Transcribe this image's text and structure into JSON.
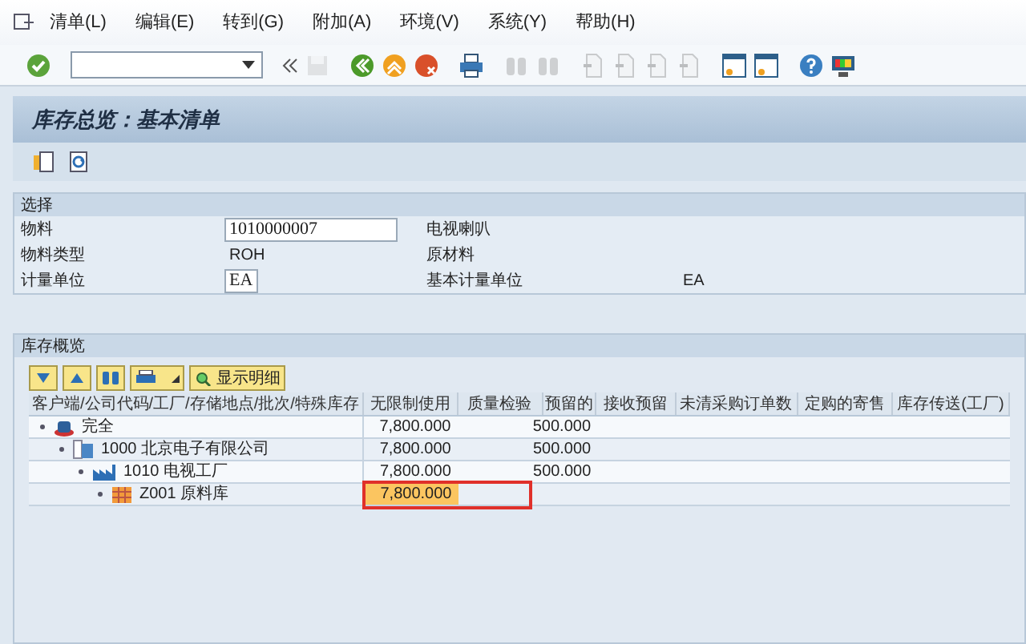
{
  "menu": [
    {
      "label": "清单(L)"
    },
    {
      "label": "编辑(E)"
    },
    {
      "label": "转到(G)"
    },
    {
      "label": "附加(A)"
    },
    {
      "label": "环境(V)"
    },
    {
      "label": "系统(Y)"
    },
    {
      "label": "帮助(H)"
    }
  ],
  "toolbar": {
    "buttons": [
      {
        "kind": "enter",
        "disabled": false
      },
      {
        "kind": "save",
        "disabled": true
      },
      {
        "kind": "back",
        "disabled": false
      },
      {
        "kind": "exit",
        "disabled": false
      },
      {
        "kind": "cancel",
        "disabled": false
      },
      {
        "kind": "print",
        "disabled": false
      },
      {
        "kind": "find",
        "disabled": true
      },
      {
        "kind": "find",
        "disabled": true
      },
      {
        "kind": "page",
        "disabled": true
      },
      {
        "kind": "page",
        "disabled": true
      },
      {
        "kind": "page",
        "disabled": true
      },
      {
        "kind": "page",
        "disabled": true
      },
      {
        "kind": "window",
        "disabled": false
      },
      {
        "kind": "window",
        "disabled": false
      },
      {
        "kind": "help",
        "disabled": false
      },
      {
        "kind": "monitor",
        "disabled": false
      }
    ]
  },
  "title": "库存总览：基本清单",
  "selection": {
    "title": "选择",
    "rows": [
      {
        "label": "物料",
        "kind": "field",
        "value": "1010000007",
        "description": "电视喇叭"
      },
      {
        "label": "物料类型",
        "kind": "text",
        "value": "ROH",
        "description": "原材料"
      },
      {
        "label": "计量单位",
        "kind": "small-field",
        "value": "EA",
        "description": "基本计量单位",
        "extra": "EA"
      }
    ]
  },
  "overview": {
    "title": "库存概览",
    "detail_button": "显示明细",
    "columns": [
      "客户端/公司代码/工厂/存储地点/批次/特殊库存",
      "无限制使用",
      "质量检验",
      "预留的",
      "接收预留",
      "未清采购订单数",
      "定购的寄售",
      "库存传送(工厂)"
    ],
    "tree": [
      {
        "kind": "client",
        "label": "完全",
        "cells": [
          "7,800.000",
          "",
          "500.000",
          "",
          "",
          "",
          ""
        ],
        "selected": false,
        "marked": false,
        "children": [
          {
            "kind": "company",
            "label": "1000 北京电子有限公司",
            "cells": [
              "7,800.000",
              "",
              "500.000",
              "",
              "",
              "",
              ""
            ],
            "selected": false,
            "marked": false,
            "children": [
              {
                "kind": "plant",
                "label": "1010 电视工厂",
                "cells": [
                  "7,800.000",
                  "",
                  "500.000",
                  "",
                  "",
                  "",
                  ""
                ],
                "selected": false,
                "marked": false,
                "children": [
                  {
                    "kind": "storage",
                    "label": "Z001 原料库",
                    "cells": [
                      "7,800.000",
                      "",
                      "",
                      "",
                      "",
                      "",
                      ""
                    ],
                    "selected": true,
                    "marked": true
                  }
                ]
              }
            ]
          }
        ]
      }
    ]
  }
}
